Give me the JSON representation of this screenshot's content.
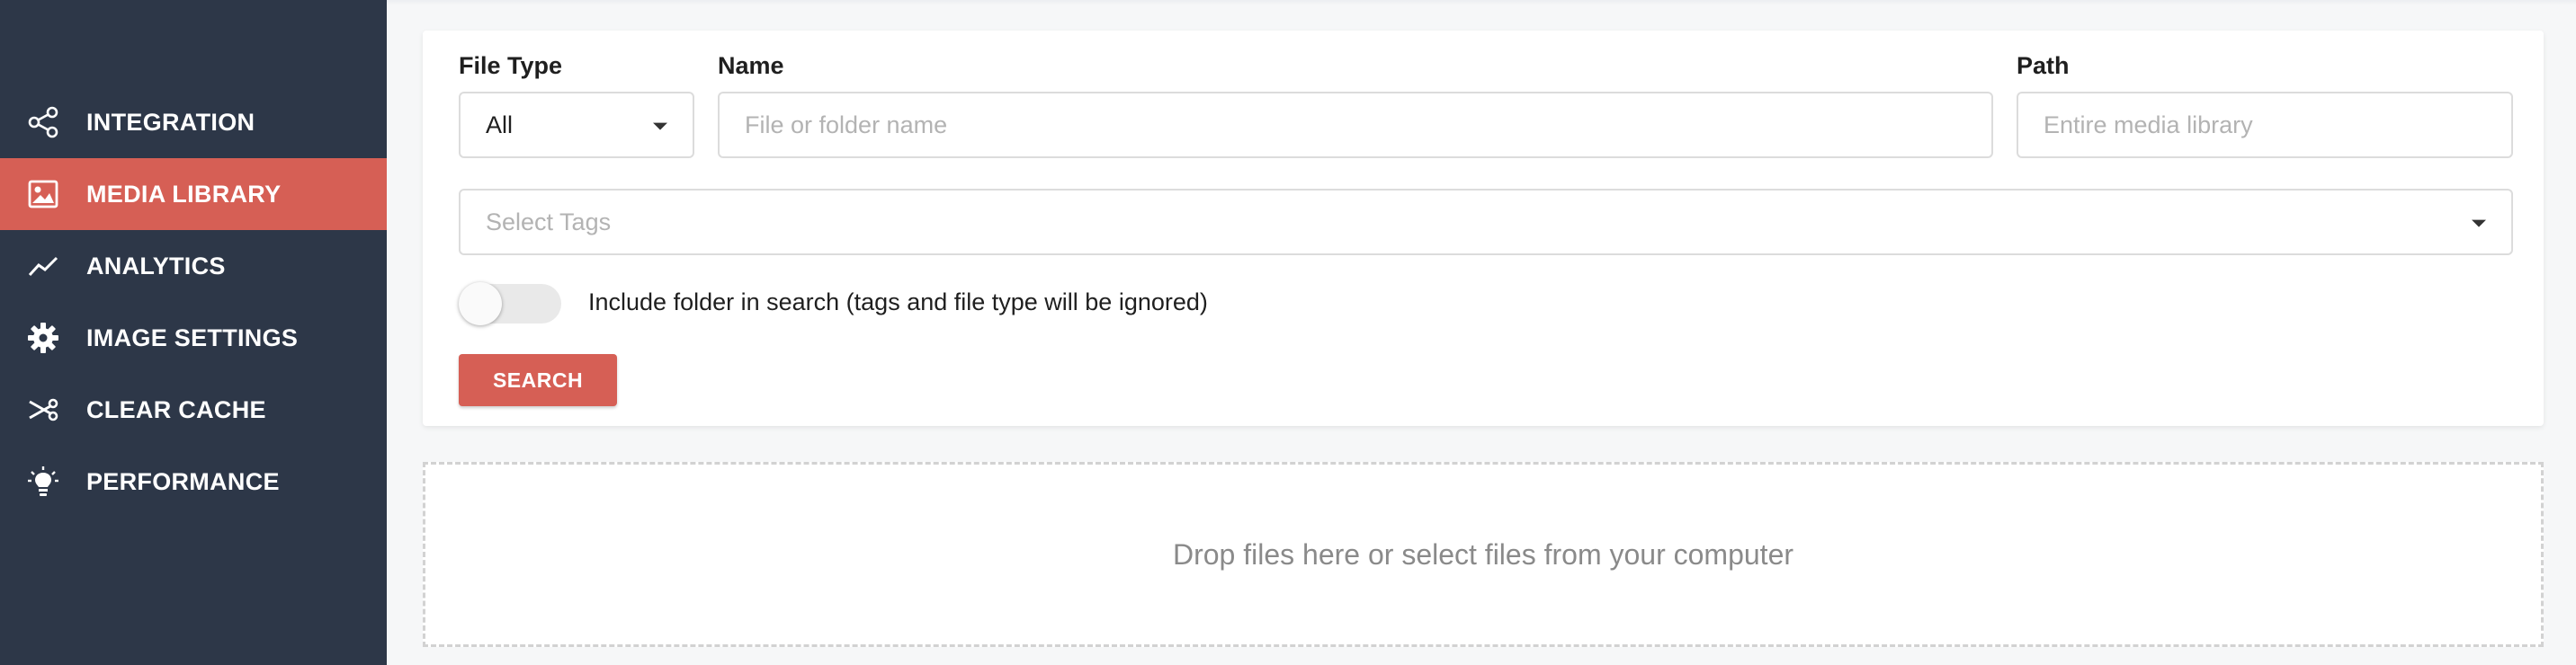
{
  "sidebar": {
    "items": [
      {
        "label": "INTEGRATION",
        "icon": "share-icon",
        "active": false
      },
      {
        "label": "MEDIA LIBRARY",
        "icon": "image-icon",
        "active": true
      },
      {
        "label": "ANALYTICS",
        "icon": "trend-line-icon",
        "active": false
      },
      {
        "label": "IMAGE SETTINGS",
        "icon": "gear-icon",
        "active": false
      },
      {
        "label": "CLEAR CACHE",
        "icon": "scissors-icon",
        "active": false
      },
      {
        "label": "PERFORMANCE",
        "icon": "lightbulb-icon",
        "active": false
      }
    ]
  },
  "search_form": {
    "file_type": {
      "label": "File Type",
      "value": "All"
    },
    "name": {
      "label": "Name",
      "placeholder": "File or folder name"
    },
    "path": {
      "label": "Path",
      "placeholder": "Entire media library"
    },
    "tags": {
      "placeholder": "Select Tags"
    },
    "include_folder": {
      "label": "Include folder in search (tags and file type will be ignored)",
      "enabled": false
    },
    "search_button": "SEARCH"
  },
  "dropzone": {
    "text": "Drop files here or select files from your computer"
  },
  "colors": {
    "sidebar_bg": "#2d3748",
    "accent": "#d65f55"
  }
}
